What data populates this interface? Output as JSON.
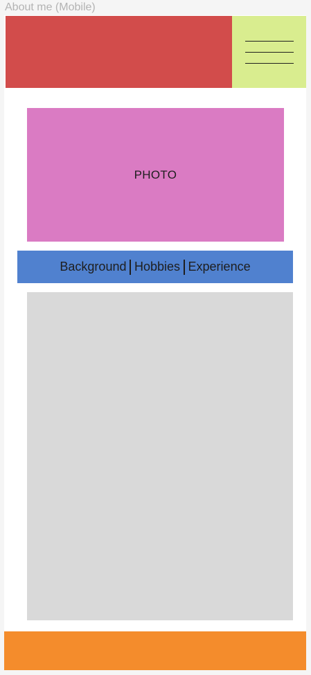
{
  "frame": {
    "label": "About me (Mobile)"
  },
  "photo": {
    "label": "PHOTO"
  },
  "tabs": [
    {
      "label": "Background"
    },
    {
      "label": "Hobbies"
    },
    {
      "label": "Experience"
    }
  ],
  "menu": {
    "icon": "hamburger-menu-icon"
  },
  "colors": {
    "header": "#d24c4b",
    "menu": "#d9ed8f",
    "photo": "#da7bc3",
    "tabs": "#5081cf",
    "content": "#d9d9d9",
    "footer": "#f48c2c"
  }
}
